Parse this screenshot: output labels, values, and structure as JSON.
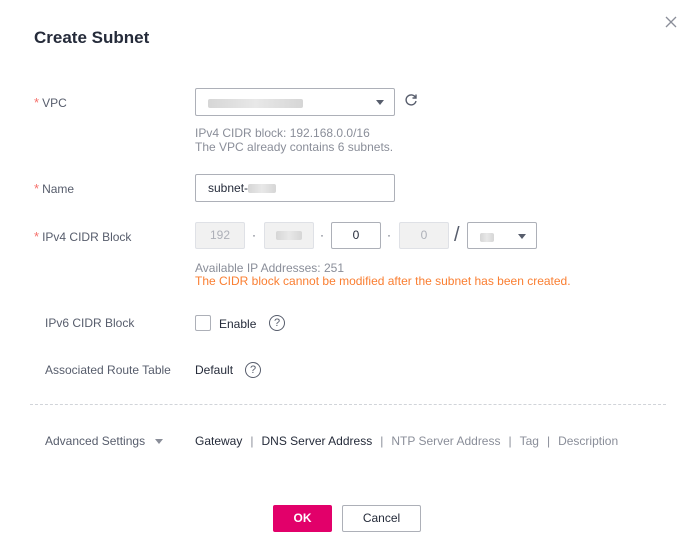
{
  "dialog": {
    "title": "Create Subnet",
    "close_icon": "close-icon"
  },
  "form": {
    "vpc": {
      "label": "VPC",
      "required": true,
      "value_masked": true,
      "refresh_icon": "refresh-icon",
      "hint_cidr": "IPv4 CIDR block: 192.168.0.0/16",
      "hint_subnets": "The VPC already contains 6 subnets."
    },
    "name": {
      "label": "Name",
      "required": true,
      "value_prefix": "subnet-",
      "value_masked": true
    },
    "ipv4_cidr": {
      "label": "IPv4 CIDR Block",
      "required": true,
      "octet1": "192",
      "octet2_masked": true,
      "octet3": "0",
      "octet4": "0",
      "separator_dot": "·",
      "separator_slash": "/",
      "mask_masked": true,
      "available": "Available IP Addresses: 251",
      "warning": "The CIDR block cannot be modified after the subnet has been created."
    },
    "ipv6_cidr": {
      "label": "IPv6 CIDR Block",
      "checkbox_label": "Enable",
      "checked": false,
      "help_icon": "?"
    },
    "route_table": {
      "label": "Associated Route Table",
      "value": "Default",
      "help_icon": "?"
    },
    "required_marker": "*"
  },
  "advanced": {
    "label": "Advanced Settings",
    "items": [
      {
        "label": "Gateway",
        "active": true
      },
      {
        "label": "DNS Server Address",
        "active": true
      },
      {
        "label": "NTP Server Address",
        "active": false
      },
      {
        "label": "Tag",
        "active": false
      },
      {
        "label": "Description",
        "active": false
      }
    ],
    "separator": "|"
  },
  "footer": {
    "ok_label": "OK",
    "cancel_label": "Cancel"
  },
  "colors": {
    "primary": "#e2006a",
    "required": "#f66f6a",
    "warning": "#fa7e31"
  }
}
